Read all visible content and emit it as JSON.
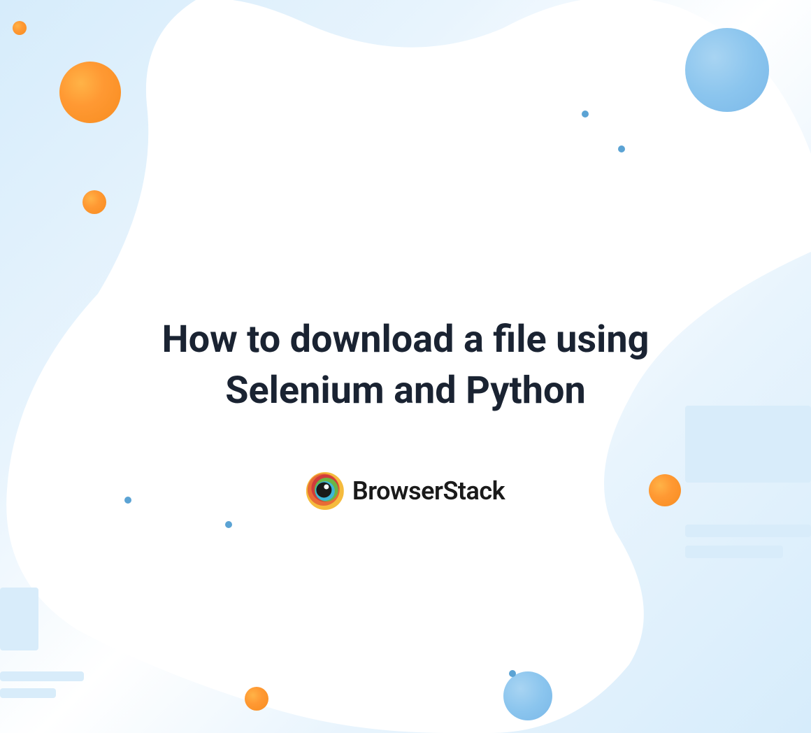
{
  "title": "How to download a file using Selenium and Python",
  "logo": {
    "text": "BrowserStack"
  },
  "colors": {
    "orange": "#f78c1f",
    "blue": "#8bc5ee",
    "darkText": "#1a2332",
    "lightBlue": "#d8ecfa"
  }
}
